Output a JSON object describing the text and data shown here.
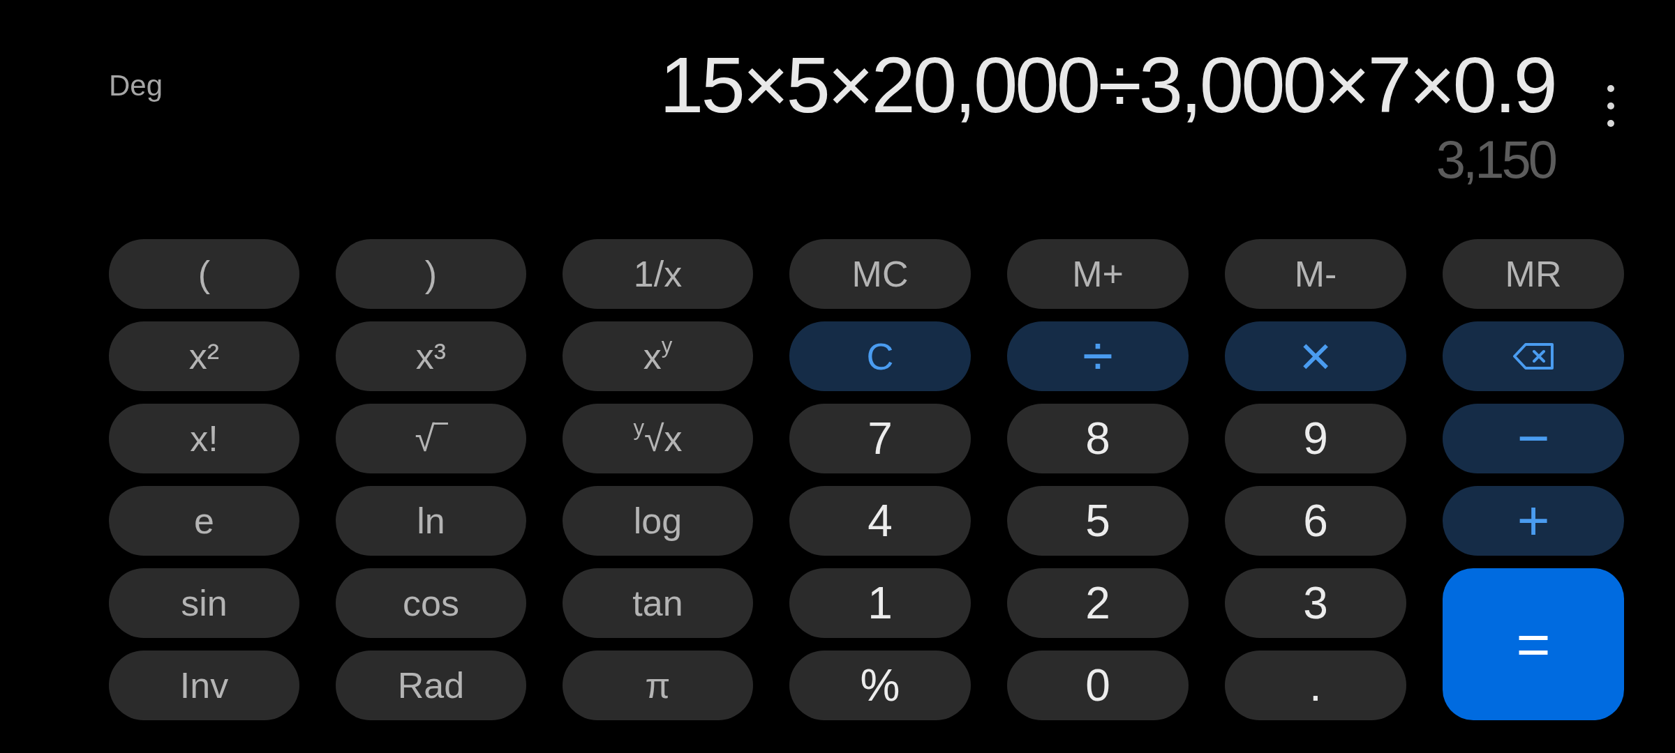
{
  "display": {
    "angle_mode": "Deg",
    "expression": "15×5×20,000÷3,000×7×0.9",
    "result": "3,150"
  },
  "keys": [
    {
      "kind": "function",
      "label": "("
    },
    {
      "kind": "function",
      "label": ")"
    },
    {
      "kind": "function",
      "label": "1/x"
    },
    {
      "kind": "function",
      "label": "MC"
    },
    {
      "kind": "function",
      "label": "M+"
    },
    {
      "kind": "function",
      "label": "M-"
    },
    {
      "kind": "function",
      "label": "MR"
    },
    {
      "kind": "function",
      "label": "x²"
    },
    {
      "kind": "function",
      "label": "x³"
    },
    {
      "kind": "function",
      "label": "x$^{y}$"
    },
    {
      "kind": "clear",
      "label": "C"
    },
    {
      "kind": "operator",
      "label": "÷"
    },
    {
      "kind": "operator",
      "label": "×"
    },
    {
      "kind": "backspace"
    },
    {
      "kind": "function",
      "label": "x!"
    },
    {
      "kind": "function",
      "label": "√‾"
    },
    {
      "kind": "function",
      "label": "$^{y}$√x"
    },
    {
      "kind": "digit",
      "label": "7"
    },
    {
      "kind": "digit",
      "label": "8"
    },
    {
      "kind": "digit",
      "label": "9"
    },
    {
      "kind": "operator",
      "label": "−"
    },
    {
      "kind": "function",
      "label": "e"
    },
    {
      "kind": "function",
      "label": "ln"
    },
    {
      "kind": "function",
      "label": "log"
    },
    {
      "kind": "digit",
      "label": "4"
    },
    {
      "kind": "digit",
      "label": "5"
    },
    {
      "kind": "digit",
      "label": "6"
    },
    {
      "kind": "operator",
      "label": "+"
    },
    {
      "kind": "function",
      "label": "sin"
    },
    {
      "kind": "function",
      "label": "cos"
    },
    {
      "kind": "function",
      "label": "tan"
    },
    {
      "kind": "digit",
      "label": "1"
    },
    {
      "kind": "digit",
      "label": "2"
    },
    {
      "kind": "digit",
      "label": "3"
    },
    {
      "kind": "equals",
      "label": "="
    },
    {
      "kind": "function",
      "label": "Inv"
    },
    {
      "kind": "function",
      "label": "Rad"
    },
    {
      "kind": "function",
      "label": "π"
    },
    {
      "kind": "digit",
      "label": "%"
    },
    {
      "kind": "digit",
      "label": "0"
    },
    {
      "kind": "digit",
      "label": "."
    }
  ]
}
